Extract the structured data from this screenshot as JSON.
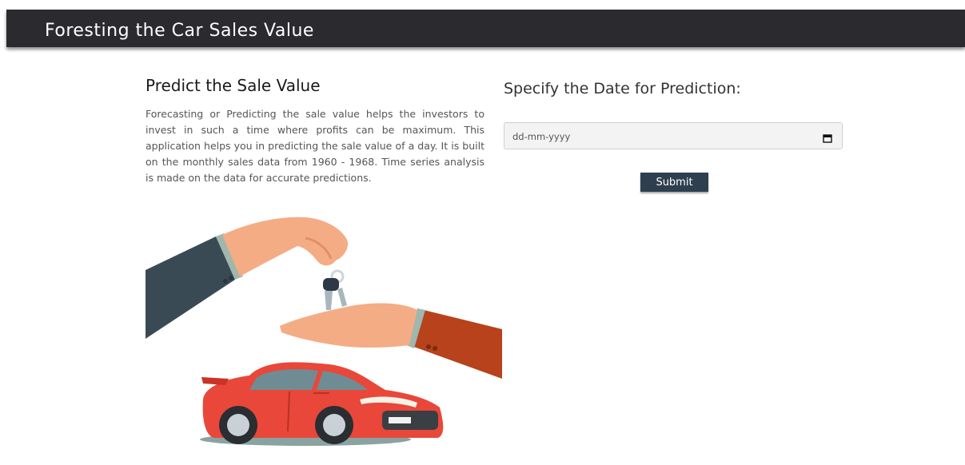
{
  "header": {
    "title": "Foresting the Car Sales Value"
  },
  "intro": {
    "title": "Predict the Sale Value",
    "description": "Forecasting or Predicting the sale value helps the investors to invest in such a time where profits can be maximum. This application helps you in predicting the sale value of a day. It is built on the monthly sales data from 1960 - 1968. Time series analysis is made on the data for accurate predictions."
  },
  "form": {
    "title": "Specify the Date for Prediction:",
    "date_placeholder": "dd-mm-yyyy",
    "submit_label": "Submit"
  },
  "icons": {
    "calendar": "calendar-icon",
    "illustration": "car-key-handover-illustration"
  },
  "colors": {
    "header_bg": "#2b2a2f",
    "submit_bg": "#2e3f4f",
    "car": "#e8473a",
    "sleeve_left": "#3a4a55",
    "sleeve_right": "#b7421b",
    "skin": "#f4ac85"
  }
}
